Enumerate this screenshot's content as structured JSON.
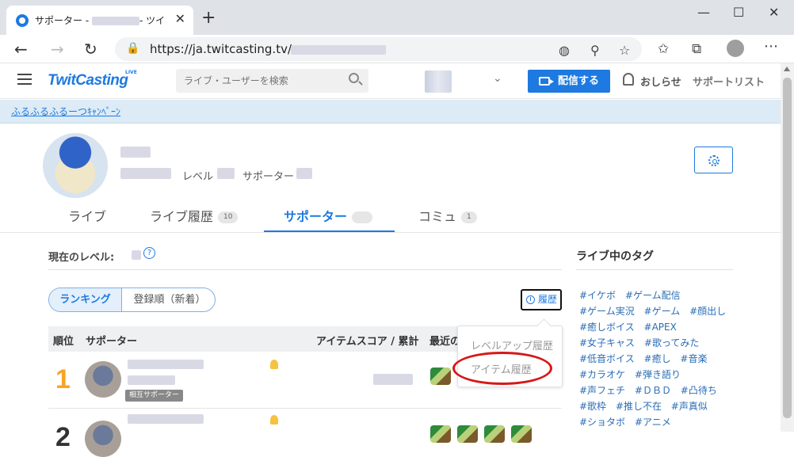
{
  "browser": {
    "tab_title": "サポーター - ",
    "tab_title_suffix": "- ツイ",
    "url": "https://ja.twitcasting.tv/"
  },
  "header": {
    "logo": "TwitCasting",
    "logo_sup": "LIVE",
    "search_placeholder": "ライブ・ユーザーを検索",
    "broadcast_label": "配信する",
    "notice_label": "おしらせ",
    "supportlist_label": "サポートリスト"
  },
  "banner": {
    "link": "ふるふるふるーつｷｬﾝﾍﾟｰﾝ"
  },
  "profile": {
    "level_label": "レベル",
    "supporter_label": "サポーター"
  },
  "tabs": [
    {
      "label": "ライブ",
      "count": ""
    },
    {
      "label": "ライブ履歴",
      "count": "10"
    },
    {
      "label": "サポーター",
      "count": ""
    },
    {
      "label": "コミュ",
      "count": "1"
    }
  ],
  "main": {
    "current_level_label": "現在のレベル:",
    "seg_ranking": "ランキング",
    "seg_registered": "登録順（新着）",
    "history_button": "履歴",
    "columns": {
      "rank": "順位",
      "supporter": "サポーター",
      "score": "アイテムスコア / 累計",
      "recent": "最近の"
    },
    "rows": [
      {
        "rank": "1",
        "badge": "相互サポーター"
      },
      {
        "rank": "2"
      }
    ]
  },
  "dropdown": {
    "items": [
      "レベルアップ履歴",
      "アイテム履歴"
    ]
  },
  "sidebar": {
    "title": "ライブ中のタグ",
    "tags": [
      "#イケボ",
      "#ゲーム配信",
      "#ゲーム実況",
      "#ゲーム",
      "#顔出し",
      "#癒しボイス",
      "#APEX",
      "#女子キャス",
      "#歌ってみた",
      "#低音ボイス",
      "#癒し",
      "#音楽",
      "#カラオケ",
      "#弾き語り",
      "#声フェチ",
      "#ＤＢＤ",
      "#凸待ち",
      "#歌枠",
      "#推し不在",
      "#声真似",
      "#ショタボ",
      "#アニメ"
    ]
  },
  "colors": {
    "accent": "#1e7ae0",
    "rank1": "#f5a623",
    "highlight": "#d61818"
  }
}
